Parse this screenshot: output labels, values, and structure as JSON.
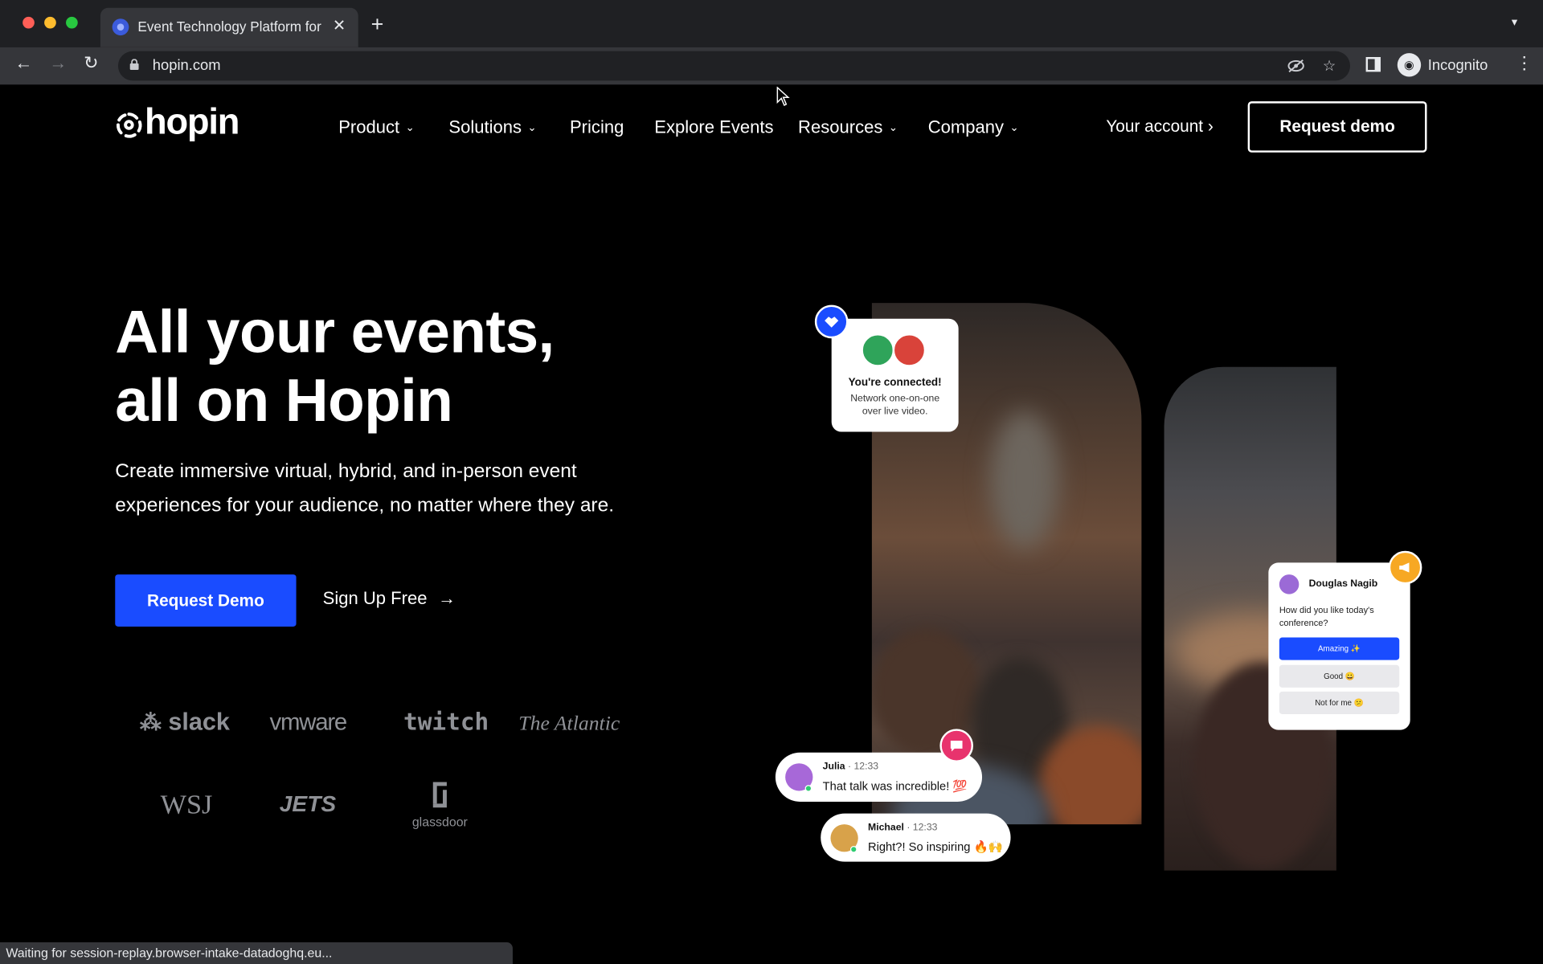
{
  "browser": {
    "tab_title": "Event Technology Platform for",
    "tab_close": "✕",
    "new_tab": "+",
    "url": "hopin.com",
    "profile_label": "Incognito",
    "status_text": "Waiting for session-replay.browser-intake-datadoghq.eu..."
  },
  "site": {
    "logo_text": "hopin",
    "nav": [
      {
        "label": "Product",
        "has_dropdown": true
      },
      {
        "label": "Solutions",
        "has_dropdown": true
      },
      {
        "label": "Pricing",
        "has_dropdown": false
      },
      {
        "label": "Explore Events",
        "has_dropdown": false
      },
      {
        "label": "Resources",
        "has_dropdown": true
      },
      {
        "label": "Company",
        "has_dropdown": true
      }
    ],
    "account_link": "Your account ›",
    "request_demo_nav": "Request demo"
  },
  "hero": {
    "title_line1": "All your events,",
    "title_line2": "all on Hopin",
    "subtitle": "Create immersive virtual, hybrid, and in-person event experiences for your audience, no matter where they are.",
    "primary_cta": "Request Demo",
    "secondary_cta": "Sign Up Free"
  },
  "clients": {
    "slack": "slack",
    "vmware": "vmware",
    "twitch": "twitch",
    "atlantic": "The Atlantic",
    "wsj": "WSJ",
    "jets": "JETS",
    "glassdoor": "glassdoor"
  },
  "connected_card": {
    "title": "You're connected!",
    "description": "Network one-on-one over live video."
  },
  "poll_card": {
    "name": "Douglas Nagib",
    "question": "How did you like today's conference?",
    "options": [
      "Amazing ✨",
      "Good 😀",
      "Not for me 😕"
    ]
  },
  "chats": [
    {
      "name": "Julia",
      "time": "12:33",
      "message": "That talk was incredible! 💯"
    },
    {
      "name": "Michael",
      "time": "12:33",
      "message": "Right?! So inspiring 🔥🙌"
    }
  ],
  "colors": {
    "brand_blue": "#1a4cff",
    "chat_badge_pink": "#e8336d",
    "poll_badge_yellow": "#f7a823"
  }
}
